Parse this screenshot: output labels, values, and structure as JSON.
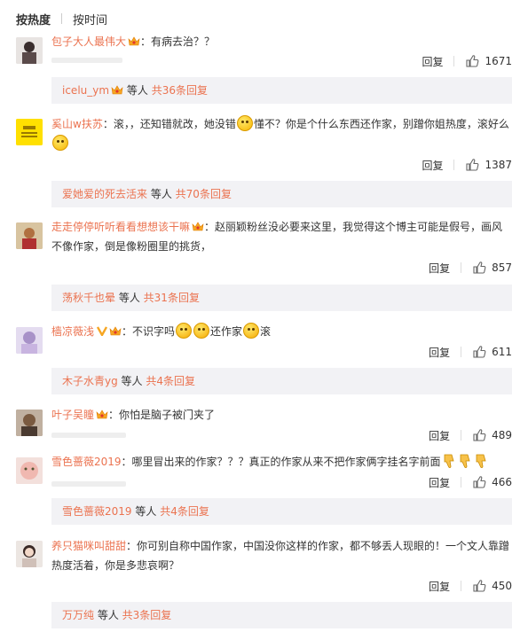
{
  "tabs": {
    "hot": "按热度",
    "time": "按时间"
  },
  "action_reply": "回复",
  "comments": [
    {
      "user": "包子大人最伟大",
      "text": "：有病去治？？",
      "likes": "1671",
      "reply_user": "icelu_ym",
      "reply_mid": " 等人",
      "reply_count": "共36条回复"
    },
    {
      "user": "奚山w扶苏",
      "text_a": "：滚，，还知错就改，她没错",
      "text_b": "懂不？你是个什么东西还作家，别蹭你姐热度，滚好么",
      "likes": "1387",
      "reply_user": "爱她爱的死去活来",
      "reply_mid": " 等人",
      "reply_count": "共70条回复"
    },
    {
      "user": "走走停停听听看看想想该干嘛",
      "text": "：赵丽颖粉丝没必要来这里，我觉得这个博主可能是假号，画风",
      "text2": "不像作家，倒是像粉圈里的挑货，",
      "likes": "857",
      "reply_user": "荡秋千也晕",
      "reply_mid": " 等人",
      "reply_count": "共31条回复"
    },
    {
      "user": "樯凉薇浅",
      "text_a": "：不识字吗",
      "text_b": "还作家",
      "text_c": "滚",
      "likes": "611",
      "reply_user": "木子水青yg",
      "reply_mid": " 等人",
      "reply_count": "共4条回复"
    },
    {
      "user": "叶子吴瞳",
      "text": "：你怕是脑子被门夹了",
      "likes": "489"
    },
    {
      "user": "雪色蔷薇2019",
      "text": "：哪里冒出来的作家？？？真正的作家从来不把作家俩字挂名字前面",
      "likes": "466",
      "reply_user": "雪色蔷薇2019",
      "reply_mid": " 等人",
      "reply_count": "共4条回复"
    },
    {
      "user": "养只猫咪叫甜甜",
      "text": "：你可别自称中国作家，中国没你这样的作家，都不够丢人现眼的！一个文人靠蹭",
      "text2": "热度活着，你是多悲哀啊？",
      "likes": "450",
      "reply_user": "万万纯",
      "reply_mid": " 等人",
      "reply_count": "共3条回复"
    }
  ],
  "colors": {
    "username": "#eb7350",
    "reply_bg": "#f2f2f5",
    "text": "#333333"
  }
}
